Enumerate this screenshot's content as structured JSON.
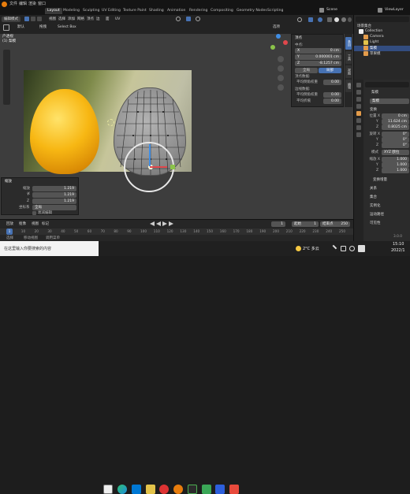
{
  "topbar": {
    "menus": [
      "文件",
      "编辑",
      "渲染",
      "窗口",
      "帮助"
    ],
    "workspaces": [
      "Layout",
      "Modeling",
      "Sculpting",
      "UV Editing",
      "Texture Paint",
      "Shading",
      "Animation",
      "Rendering",
      "Compositing",
      "Geometry Nodes",
      "Scripting"
    ],
    "active_workspace": "Layout",
    "scene_label": "Scene",
    "viewlayer_label": "ViewLayer"
  },
  "viewport_header": {
    "mode": "编辑模式",
    "view": "视图",
    "select": "选择",
    "add": "添加",
    "mesh": "网格",
    "vertex": "顶点",
    "edge": "边",
    "face": "面",
    "uv": "UV",
    "select_box": "Select Box",
    "orientation": "默认",
    "pivot": "拖拽",
    "overlay_label": "选项"
  },
  "viewport_overlay": {
    "view_name": "户透视",
    "object_name": "(1) 梨模"
  },
  "n_panel": {
    "title": "顶点",
    "median_label": "中点:",
    "x_label": "X",
    "x_value": "0 cm",
    "y_label": "Y",
    "y_value": "0.000001 cm",
    "z_label": "Z",
    "z_value": "-8.1257 cm",
    "global_btn": "全局",
    "local_btn": "局部",
    "vertex_data": "顶点数据:",
    "bevel_weight_label": "平均倒角权重",
    "bevel_weight_value": "0.00",
    "edge_data": "边线数据:",
    "edge_bevel_label": "平均倒角权重",
    "edge_bevel_value": "0.00",
    "crease_label": "平均折痕",
    "crease_value": "0.00",
    "tabs": [
      "条目",
      "工具",
      "视图",
      "编辑"
    ]
  },
  "last_op": {
    "title": "缩放",
    "scale_x_label": "缩放 X",
    "scale_x": "1.219",
    "scale_y_label": "Y",
    "scale_y": "1.219",
    "scale_z_label": "Z",
    "scale_z": "1.219",
    "orient_label": "坐标系",
    "orient_value": "全局",
    "prop_label": "衰减编辑"
  },
  "timeline": {
    "playback": "回放",
    "keying": "抠像",
    "view": "视图",
    "marker": "标记",
    "current_frame": "1",
    "start_label": "起始",
    "start": "1",
    "end_label": "结束点",
    "end": "250",
    "ticks": [
      "0",
      "10",
      "20",
      "30",
      "40",
      "50",
      "60",
      "70",
      "80",
      "90",
      "100",
      "110",
      "120",
      "130",
      "140",
      "150",
      "160",
      "170",
      "180",
      "190",
      "200",
      "210",
      "220",
      "230",
      "240",
      "250"
    ],
    "status_select": "选择",
    "status_move": "移动视图",
    "status_menu": "调用菜单",
    "version": "3.0.0"
  },
  "outliner": {
    "title": "场景集合",
    "items": [
      {
        "name": "场景集合",
        "level": 0
      },
      {
        "name": "Collection",
        "level": 1
      },
      {
        "name": "Camera",
        "level": 2
      },
      {
        "name": "Light",
        "level": 2
      },
      {
        "name": "梨模",
        "level": 2
      },
      {
        "name": "苹果模",
        "level": 2
      }
    ]
  },
  "properties": {
    "object_name": "梨模",
    "section_transform": "变换",
    "loc_label": "位置 X",
    "loc_x": "0 cm",
    "loc_y_label": "Y",
    "loc_y": "11.624 cm",
    "loc_z_label": "Z",
    "loc_z": "0.8025 cm",
    "rot_label": "旋转 X",
    "rot_x": "0°",
    "rot_y_label": "Y",
    "rot_y": "0°",
    "rot_z_label": "Z",
    "rot_z": "0°",
    "mode_label": "模式",
    "mode_value": "XYZ 欧拉",
    "scale_label": "缩放 X",
    "scale_x": "1.000",
    "scale_y_label": "Y",
    "scale_y": "1.000",
    "scale_z_label": "Z",
    "scale_z": "1.000",
    "delta": "变换增量",
    "relations": "关系",
    "collections": "集合",
    "instancing": "实例化",
    "motion_paths": "运动路径",
    "visibility": "可见性"
  },
  "taskbar": {
    "search_placeholder": "在这里输入你要搜索的内容",
    "temp": "2°C 多云",
    "time": "15:10",
    "date": "2022/1"
  },
  "colors": {
    "accent": "#4772b3",
    "x_axis": "#e0474c",
    "y_axis": "#8bc34a",
    "z_axis": "#3f8ee5"
  }
}
